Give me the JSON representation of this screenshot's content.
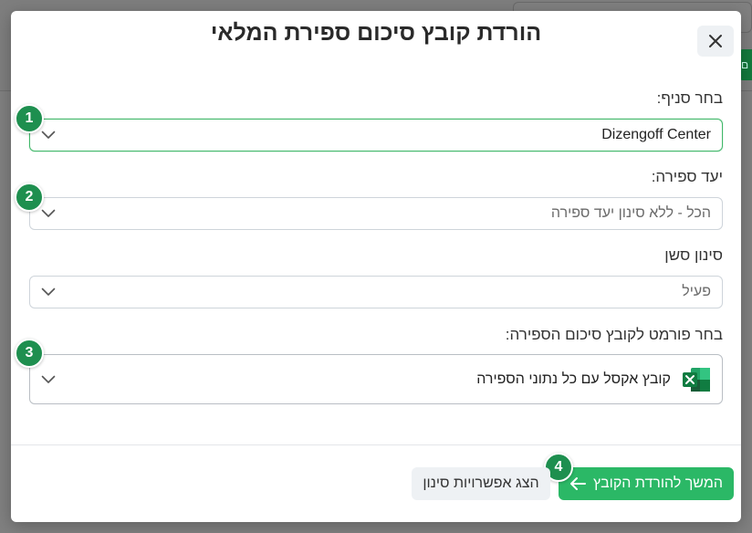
{
  "background": {
    "button_text": "ם"
  },
  "modal": {
    "title": "הורדת קובץ סיכום ספירת המלאי",
    "close_icon": "close-icon"
  },
  "fields": {
    "branch": {
      "label": "בחר סניף:",
      "value": "Dizengoff Center",
      "step": "1"
    },
    "count_target": {
      "label": "יעד ספירה:",
      "value": "הכל - ללא סינון יעד ספירה",
      "step": "2"
    },
    "session_filter": {
      "label": "סינון סשן",
      "value": "פעיל"
    },
    "format": {
      "label": "בחר פורמט לקובץ סיכום הספירה:",
      "value": "קובץ אקסל עם כל נתוני הספירה",
      "icon": "excel-icon",
      "step": "3"
    }
  },
  "footer": {
    "continue_label": "המשך להורדת הקובץ",
    "filters_label": "הצג אפשרויות סינון",
    "step": "4"
  },
  "colors": {
    "accent": "#2bb866",
    "badge": "#1e8f4f",
    "active_border": "#41b86a"
  }
}
